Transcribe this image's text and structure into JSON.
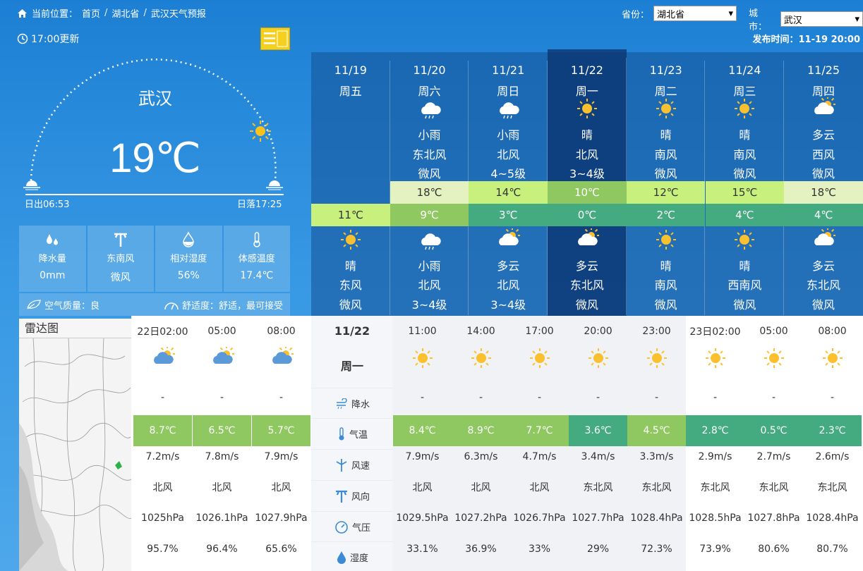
{
  "breadcrumb": {
    "prefix": "当前位置：",
    "home": "首页",
    "province": "湖北省",
    "page": "武汉天气预报"
  },
  "selectors": {
    "province_label": "省份：",
    "province_value": "湖北省",
    "city_label": "城市：",
    "city_value": "武汉"
  },
  "update_text": "17:00更新",
  "publish_text": "发布时间：11-19 20:00",
  "current": {
    "city": "武汉",
    "temp": "19℃",
    "sunrise": "日出06:53",
    "sunset": "日落17:25"
  },
  "stats": [
    {
      "label": "降水量",
      "value": "0mm",
      "icon": "raindrop-icon"
    },
    {
      "label": "东南风",
      "value": "微风",
      "icon": "wind-icon"
    },
    {
      "label": "相对湿度",
      "value": "56%",
      "icon": "humidity-icon"
    },
    {
      "label": "体感温度",
      "value": "17.4℃",
      "icon": "thermometer-icon"
    }
  ],
  "air": {
    "quality": "空气质量：良",
    "comfort": "舒适度：舒适，最可接受"
  },
  "week": [
    {
      "date": "11/19",
      "weekday": "周五",
      "day_icon": "",
      "day_desc": "",
      "day_wind": "",
      "day_level": "",
      "high": "",
      "low": "11℃",
      "night_icon": "sun",
      "night_desc": "晴",
      "night_wind": "东风",
      "night_level": "微风"
    },
    {
      "date": "11/20",
      "weekday": "周六",
      "day_icon": "rain",
      "day_desc": "小雨",
      "day_wind": "东北风",
      "day_level": "微风",
      "high": "18℃",
      "low": "9℃",
      "night_icon": "rain",
      "night_desc": "小雨",
      "night_wind": "北风",
      "night_level": "3~4级"
    },
    {
      "date": "11/21",
      "weekday": "周日",
      "day_icon": "rain",
      "day_desc": "小雨",
      "day_wind": "北风",
      "day_level": "4~5级",
      "high": "14℃",
      "low": "3℃",
      "night_icon": "cloudsun",
      "night_desc": "多云",
      "night_wind": "北风",
      "night_level": "3~4级"
    },
    {
      "date": "11/22",
      "weekday": "周一",
      "day_icon": "sun",
      "day_desc": "晴",
      "day_wind": "北风",
      "day_level": "3~4级",
      "high": "10℃",
      "low": "0℃",
      "night_icon": "cloudsun",
      "night_desc": "多云",
      "night_wind": "东北风",
      "night_level": "微风"
    },
    {
      "date": "11/23",
      "weekday": "周二",
      "day_icon": "sun",
      "day_desc": "晴",
      "day_wind": "南风",
      "day_level": "微风",
      "high": "12℃",
      "low": "2℃",
      "night_icon": "sun",
      "night_desc": "晴",
      "night_wind": "南风",
      "night_level": "微风"
    },
    {
      "date": "11/24",
      "weekday": "周三",
      "day_icon": "sun",
      "day_desc": "晴",
      "day_wind": "南风",
      "day_level": "微风",
      "high": "15℃",
      "low": "4℃",
      "night_icon": "sun",
      "night_desc": "晴",
      "night_wind": "西南风",
      "night_level": "微风"
    },
    {
      "date": "11/25",
      "weekday": "周四",
      "day_icon": "cloudsun",
      "day_desc": "多云",
      "day_wind": "西风",
      "day_level": "微风",
      "high": "18℃",
      "low": "4℃",
      "night_icon": "cloudsun",
      "night_desc": "多云",
      "night_wind": "东北风",
      "night_level": "微风"
    }
  ],
  "band_colors": {
    "pale": "#e3f2c0",
    "lime": "#c8f07d",
    "green": "#8fc860",
    "teal": "#44aa80"
  },
  "radar_title": "雷达图",
  "selected_day": {
    "date": "11/22",
    "weekday": "周一"
  },
  "row_labels": [
    "降水",
    "气温",
    "风速",
    "风向",
    "气压",
    "湿度"
  ],
  "hours_left": [
    {
      "time": "22日02:00",
      "precip": "-",
      "temp": "8.7℃",
      "speed": "7.2m/s",
      "dir": "北风",
      "pressure": "1025hPa",
      "humidity": "95.7%"
    },
    {
      "time": "05:00",
      "precip": "-",
      "temp": "6.5℃",
      "speed": "7.8m/s",
      "dir": "北风",
      "pressure": "1026.1hPa",
      "humidity": "96.4%"
    },
    {
      "time": "08:00",
      "precip": "-",
      "temp": "5.7℃",
      "speed": "7.9m/s",
      "dir": "北风",
      "pressure": "1027.9hPa",
      "humidity": "65.6%"
    }
  ],
  "hours_right": [
    {
      "time": "11:00",
      "precip": "-",
      "temp": "8.4℃",
      "speed": "7.9m/s",
      "dir": "北风",
      "pressure": "1029.5hPa",
      "humidity": "33.1%"
    },
    {
      "time": "14:00",
      "precip": "-",
      "temp": "8.9℃",
      "speed": "6.3m/s",
      "dir": "北风",
      "pressure": "1027.2hPa",
      "humidity": "36.9%"
    },
    {
      "time": "17:00",
      "precip": "-",
      "temp": "7.7℃",
      "speed": "4.7m/s",
      "dir": "北风",
      "pressure": "1026.7hPa",
      "humidity": "33%"
    },
    {
      "time": "20:00",
      "precip": "-",
      "temp": "3.6℃",
      "speed": "3.4m/s",
      "dir": "东北风",
      "pressure": "1027.7hPa",
      "humidity": "29%"
    },
    {
      "time": "23:00",
      "precip": "-",
      "temp": "4.5℃",
      "speed": "3.3m/s",
      "dir": "东北风",
      "pressure": "1028.4hPa",
      "humidity": "72.3%"
    },
    {
      "time": "23日02:00",
      "precip": "-",
      "temp": "2.8℃",
      "speed": "2.9m/s",
      "dir": "东北风",
      "pressure": "1028.5hPa",
      "humidity": "73.9%"
    },
    {
      "time": "05:00",
      "precip": "-",
      "temp": "0.5℃",
      "speed": "2.7m/s",
      "dir": "东北风",
      "pressure": "1027.8hPa",
      "humidity": "80.6%"
    },
    {
      "time": "08:00",
      "precip": "-",
      "temp": "2.3℃",
      "speed": "2.6m/s",
      "dir": "东北风",
      "pressure": "1028.4hPa",
      "humidity": "80.7%"
    }
  ]
}
